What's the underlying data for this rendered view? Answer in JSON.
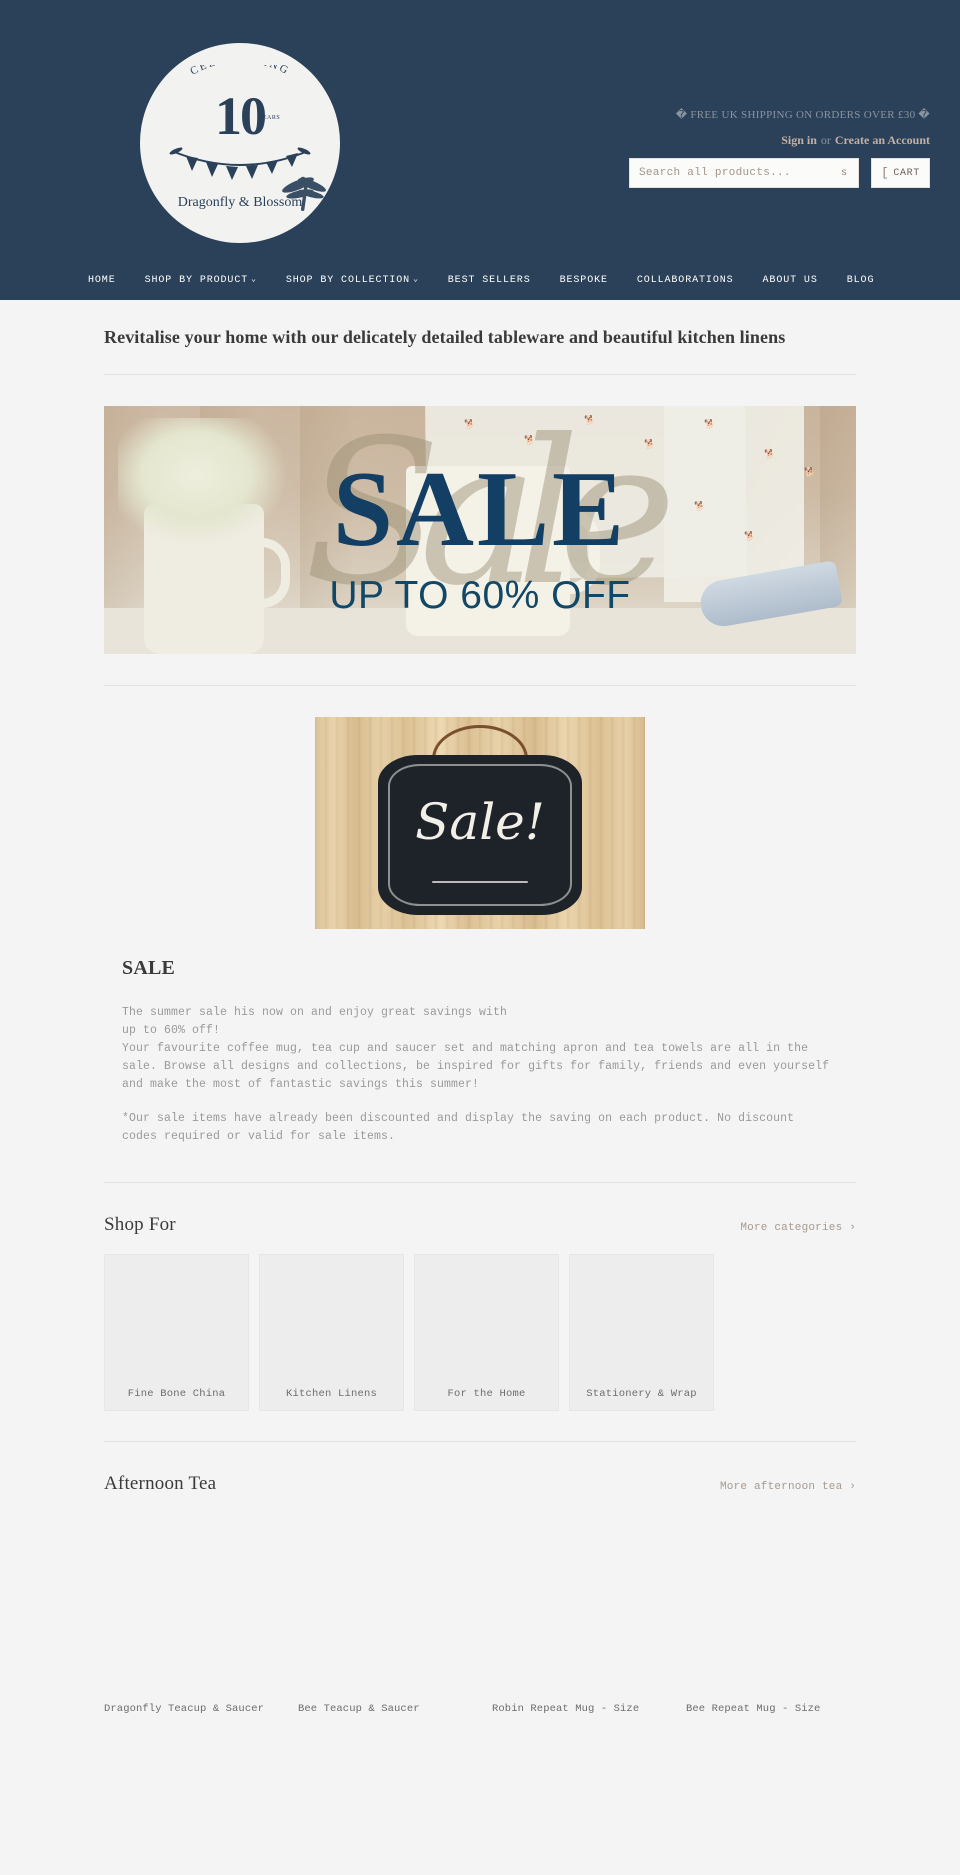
{
  "header": {
    "logo": {
      "celebrating": "CELEBRATING",
      "number": "10",
      "years": "YEARS",
      "brand": "Dragonfly & Blossom"
    },
    "shipping_banner": "� FREE UK SHIPPING ON ORDERS OVER £30 �",
    "sign_in": "Sign in",
    "or": "or",
    "create_account": "Create an Account",
    "search": {
      "placeholder": "Search all products...",
      "value": "",
      "submit_glyph": "s"
    },
    "cart": {
      "glyph": "[",
      "label": "CART"
    },
    "colors": {
      "navy": "#2b4159",
      "link": "#c3b0a6",
      "page_bg": "#f4f4f4"
    }
  },
  "nav": {
    "items": [
      {
        "label": "HOME",
        "caret": ""
      },
      {
        "label": "SHOP BY PRODUCT",
        "caret": "⌄"
      },
      {
        "label": "SHOP BY COLLECTION",
        "caret": "⌄"
      },
      {
        "label": "BEST SELLERS",
        "caret": ""
      },
      {
        "label": "BESPOKE",
        "caret": ""
      },
      {
        "label": "COLLABORATIONS",
        "caret": ""
      },
      {
        "label": "ABOUT US",
        "caret": ""
      },
      {
        "label": "BLOG",
        "caret": ""
      }
    ]
  },
  "main": {
    "tagline": "Revitalise your home with our delicately detailed tableware and beautiful kitchen linens",
    "hero": {
      "headline": "SALE",
      "subhead": "UP TO 60% OFF",
      "script_overlay": "Sale"
    },
    "sale": {
      "chalkboard_text": "Sale!",
      "heading": "SALE",
      "paragraph1": "The summer sale his now on and enjoy great savings with\nup to 60% off!\nYour favourite coffee mug, tea cup and saucer set and matching apron and tea towels are all in the sale. Browse all designs and collections, be inspired for gifts for family, friends and even yourself and make the most of fantastic savings this summer!",
      "paragraph2": "*Our sale items have already been discounted and display the saving on each product. No discount codes required or valid for sale items."
    },
    "shop_for": {
      "title": "Shop For",
      "more_label": "More categories ›",
      "categories": [
        {
          "label": "Fine Bone China"
        },
        {
          "label": "Kitchen Linens"
        },
        {
          "label": "For the Home"
        },
        {
          "label": "Stationery & Wrap"
        }
      ]
    },
    "afternoon_tea": {
      "title": "Afternoon Tea",
      "more_label": "More afternoon tea ›",
      "products": [
        {
          "name": "Dragonfly Teacup & Saucer"
        },
        {
          "name": "Bee Teacup & Saucer"
        },
        {
          "name": "Robin Repeat Mug - Size"
        },
        {
          "name": "Bee Repeat Mug - Size"
        }
      ]
    }
  }
}
